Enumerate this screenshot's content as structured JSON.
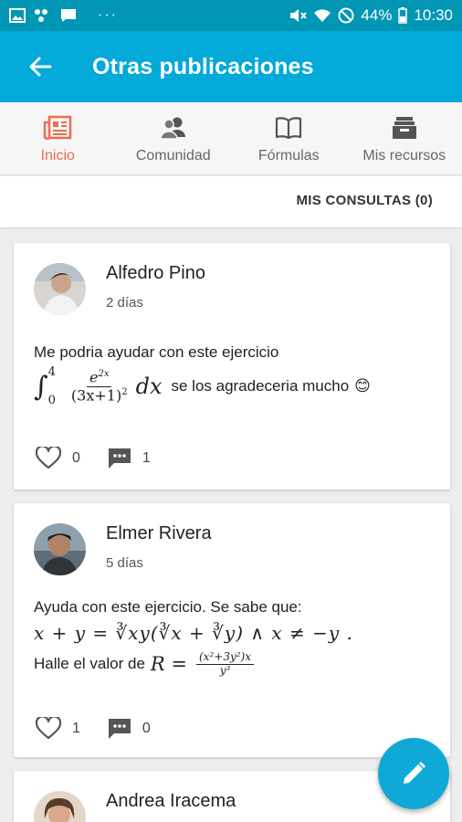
{
  "statusbar": {
    "battery": "44%",
    "time": "10:30",
    "more": "···"
  },
  "appbar": {
    "title": "Otras publicaciones"
  },
  "tabs": [
    {
      "label": "Inicio",
      "active": true
    },
    {
      "label": "Comunidad"
    },
    {
      "label": "Fórmulas"
    },
    {
      "label": "Mis recursos"
    }
  ],
  "subbar": {
    "consultas": "MIS CONSULTAS (0)"
  },
  "posts": [
    {
      "author": "Alfedro Pino",
      "time": "2 días",
      "text": "Me podria ayudar con este ejercicio",
      "math": {
        "int_upper": "4",
        "int_lower": "0",
        "numerator": "e",
        "num_exp": "2x",
        "denominator": "(3x+1)",
        "den_exp": "2",
        "dx": "dx"
      },
      "text_after": "se los agradeceria mucho",
      "emoji": "😊",
      "likes": "0",
      "comments": "1"
    },
    {
      "author": "Elmer Rivera",
      "time": "5 días",
      "text": "Ayuda con este ejercicio. Se sabe que:",
      "math_line": "x + y = ∛xy(∛x + ∛y) ∧ x ≠ −y .",
      "text2": "Halle el valor de",
      "math2": {
        "lhs": "R =",
        "numerator": "(x²+3y²)x",
        "denominator": "y³"
      },
      "likes": "1",
      "comments": "0"
    },
    {
      "author": "Andrea Iracema"
    }
  ],
  "colors": {
    "statusbar": "#0096b4",
    "appbar": "#03a9d9",
    "active_tab": "#ef6b4f",
    "fab": "#10a8d6"
  }
}
